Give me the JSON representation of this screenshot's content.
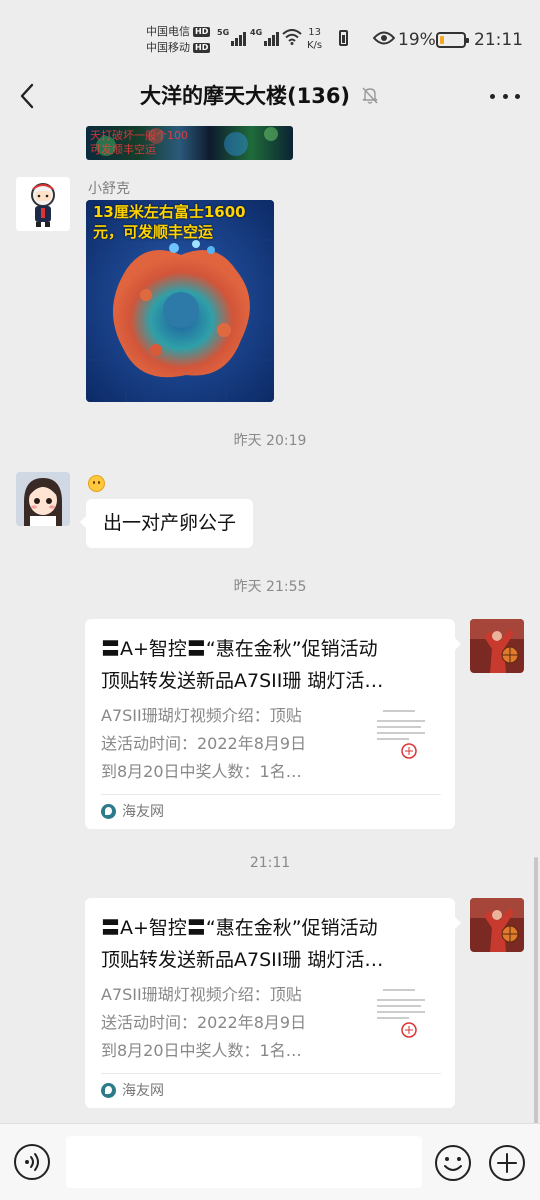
{
  "status_bar": {
    "carrier_1": "中国电信",
    "carrier_2": "中国移动",
    "hd_badge": "HD",
    "signal_1_label": "5G",
    "signal_2_label": "4G",
    "net_speed_value": "13",
    "net_speed_unit": "K/s",
    "battery_percent": "19%",
    "battery_level": 0.19,
    "battery_fill_color": "#f5a623",
    "time": "21:11",
    "icons": [
      "signal-icon",
      "wifi-icon",
      "eye-icon",
      "battery-icon"
    ]
  },
  "nav": {
    "title": "大洋的摩天大楼(136)",
    "icons": [
      "back-icon",
      "mute-bell-icon",
      "more-icon"
    ]
  },
  "messages": {
    "top_image_caption": "天打破坏一般个100\n可发顺丰空运",
    "msg1": {
      "sender": "小舒克",
      "image_caption": "13厘米左右富士1600元，可发顺丰空运"
    },
    "timestamp_1": "昨天 20:19",
    "msg2": {
      "sender_emoji": "smile-emoji-icon",
      "text": "出一对产卵公子"
    },
    "timestamp_2": "昨天 21:55",
    "card1": {
      "title_line1": "〓A+智控〓“惠在金秋”促销活动",
      "title_line2": "顶贴转发送新品A7SII珊 瑚灯活…",
      "desc_line1": "A7SII珊瑚灯视频介绍：顶贴",
      "desc_line2": "送活动时间：2022年8月9日",
      "desc_line3": "到8月20日中奖人数：1名…",
      "source": "海友网"
    },
    "timestamp_3": "21:11",
    "card2": {
      "title_line1": "〓A+智控〓“惠在金秋”促销活动",
      "title_line2": "顶贴转发送新品A7SII珊 瑚灯活…",
      "desc_line1": "A7SII珊瑚灯视频介绍：顶贴",
      "desc_line2": "送活动时间：2022年8月9日",
      "desc_line3": "到8月20日中奖人数：1名…",
      "source": "海友网"
    }
  },
  "input_bar": {
    "placeholder": "",
    "icons": [
      "voice-icon",
      "emoji-icon",
      "plus-icon"
    ]
  },
  "colors": {
    "background": "#ededed",
    "bubble": "#ffffff",
    "coral_caption": "#ffd400",
    "battery_low": "#f5a623"
  }
}
